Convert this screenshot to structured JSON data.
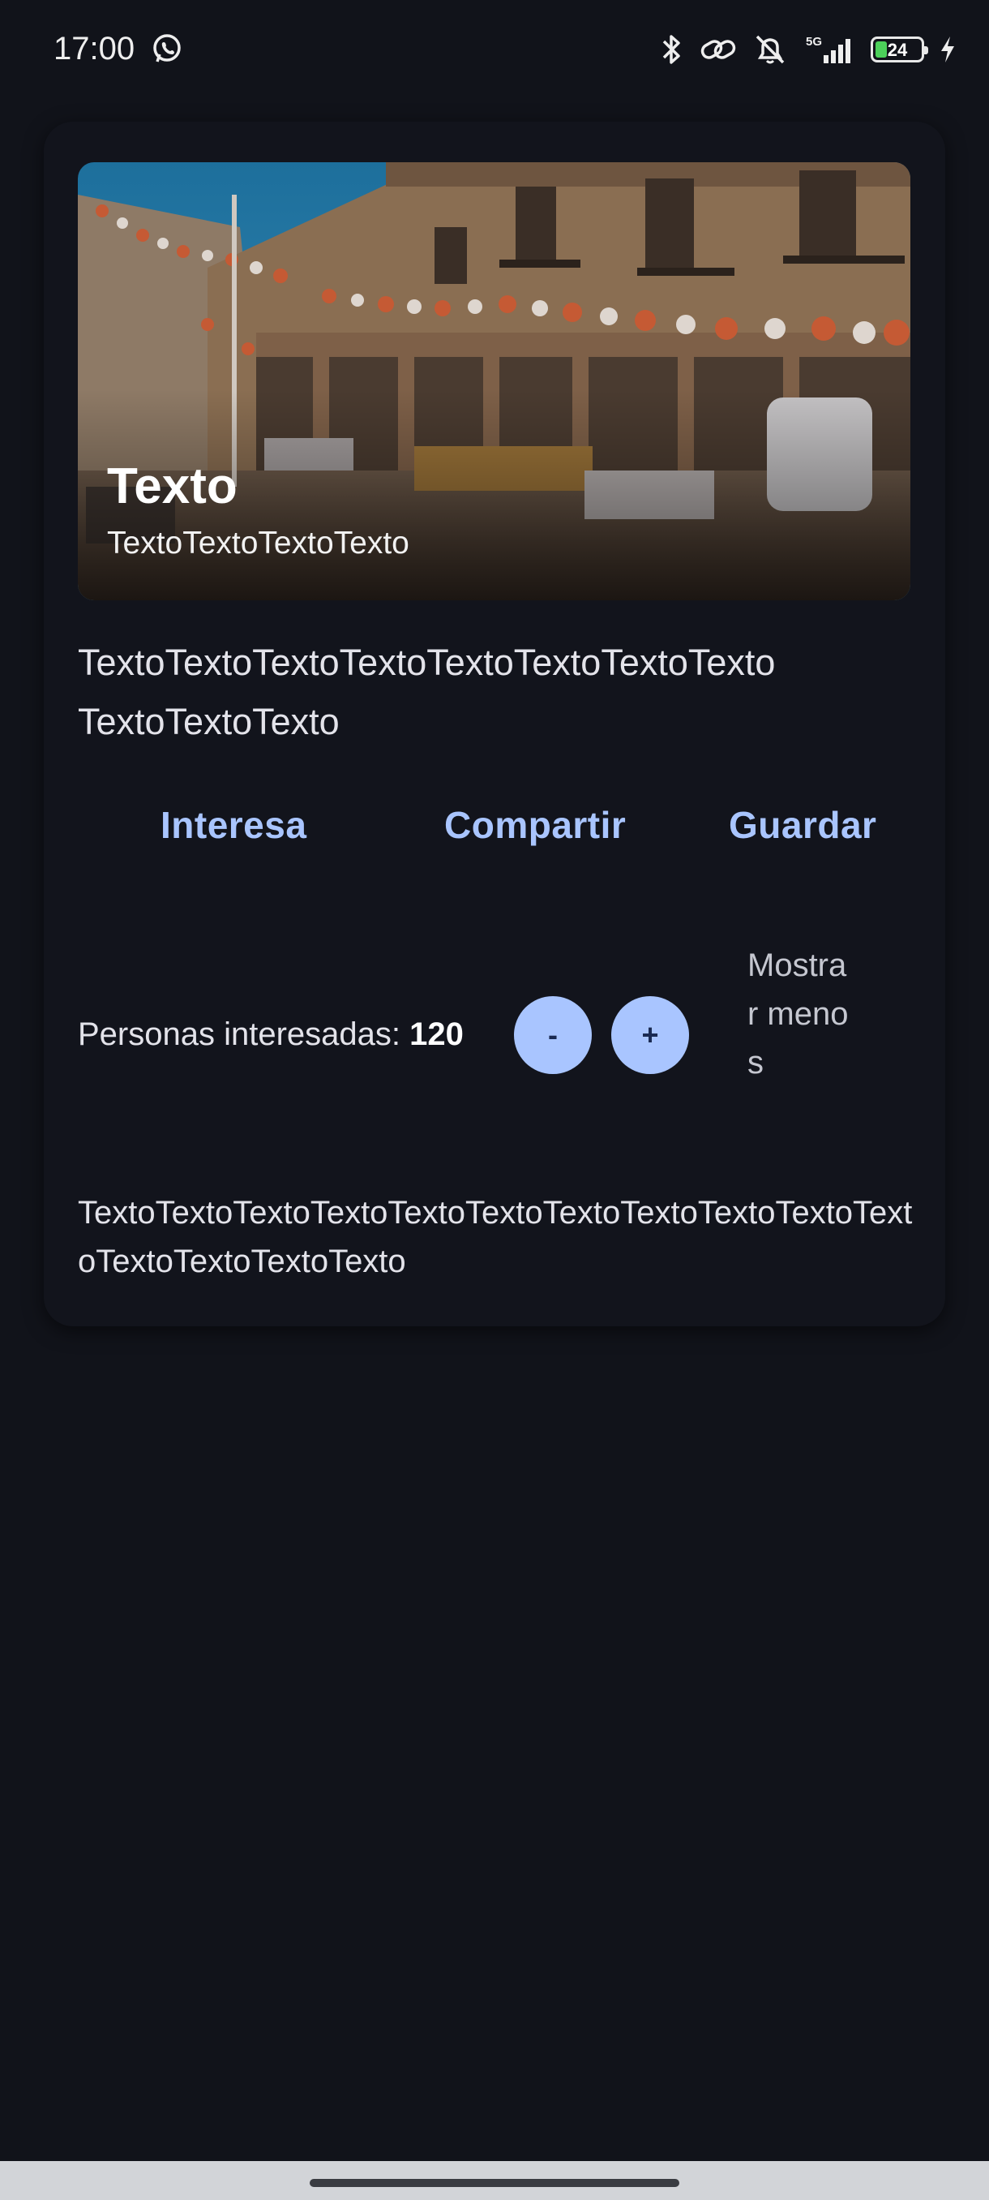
{
  "status_bar": {
    "time": "17:00",
    "battery": "24",
    "network": "5G",
    "icons": [
      "whatsapp-icon",
      "bluetooth-icon",
      "link-icon",
      "silent-icon",
      "signal-icon",
      "battery-icon",
      "charging-icon"
    ]
  },
  "card": {
    "hero": {
      "title": "Texto",
      "subtitle": "TextoTextoTextoTexto"
    },
    "description": "TextoTextoTextoTextoTextoTextoTextoTexto TextoTextoTexto",
    "actions": {
      "interest": "Interesa",
      "share": "Compartir",
      "save": "Guardar"
    },
    "counter": {
      "label": "Personas interesadas:",
      "value": "120",
      "decrement": "-",
      "increment": "+"
    },
    "toggle_label": "Mostrar menos",
    "extra_text": "TextoTextoTextoTextoTextoTextoTextoTextoTextoTextoTextoTextoTextoTextoTexto"
  },
  "colors": {
    "background": "#11131a",
    "card": "#12141c",
    "accent": "#a9c5ff",
    "text": "#e3e3ea"
  }
}
